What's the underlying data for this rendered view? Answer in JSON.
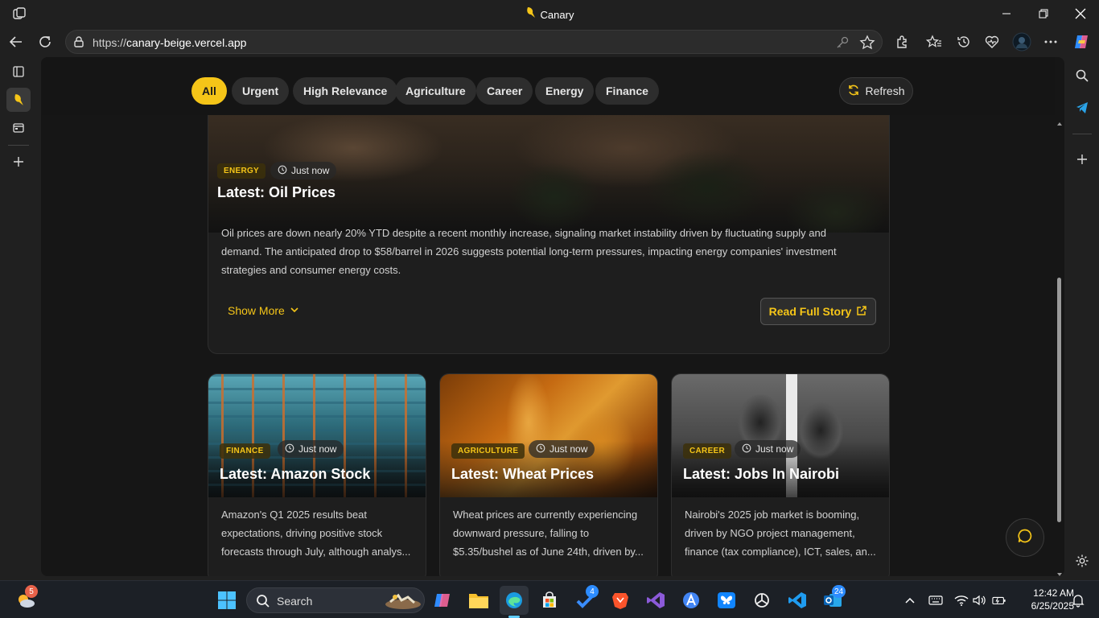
{
  "window": {
    "title": "Canary"
  },
  "browser": {
    "url_prefix": "https://",
    "url_host": "canary-beige.vercel.app"
  },
  "filters": {
    "chips": [
      "All",
      "Urgent",
      "High Relevance",
      "Agriculture",
      "Career",
      "Energy",
      "Finance"
    ],
    "active": "All",
    "refresh_label": "Refresh"
  },
  "featured": {
    "category": "ENERGY",
    "time": "Just now",
    "title": "Latest: Oil Prices",
    "summary": "Oil prices are down nearly 20% YTD despite a recent monthly increase, signaling market instability driven by fluctuating supply and demand. The anticipated drop to $58/barrel in 2026 suggests potential long-term pressures, impacting energy companies' investment strategies and consumer energy costs.",
    "show_more_label": "Show More",
    "read_full_label": "Read Full Story"
  },
  "cards": [
    {
      "category": "FINANCE",
      "time": "Just now",
      "title": "Latest: Amazon Stock",
      "summary": "Amazon's Q1 2025 results beat expectations, driving positive stock forecasts through July, although analys..."
    },
    {
      "category": "AGRICULTURE",
      "time": "Just now",
      "title": "Latest: Wheat Prices",
      "summary": "Wheat prices are currently experiencing downward pressure, falling to $5.35/bushel as of June 24th, driven by..."
    },
    {
      "category": "CAREER",
      "time": "Just now",
      "title": "Latest: Jobs In Nairobi",
      "summary": "Nairobi's 2025 job market is booming, driven by NGO project management, finance (tax compliance), ICT, sales, an..."
    }
  ],
  "taskbar": {
    "search_label": "Search",
    "widgets_badge": "5",
    "todo_badge": "4",
    "outlook_badge": "24",
    "time": "12:42 AM",
    "date": "6/25/2025"
  },
  "colors": {
    "accent": "#f5c518",
    "page_bg": "#161616",
    "card_bg": "#1e1e1e"
  }
}
